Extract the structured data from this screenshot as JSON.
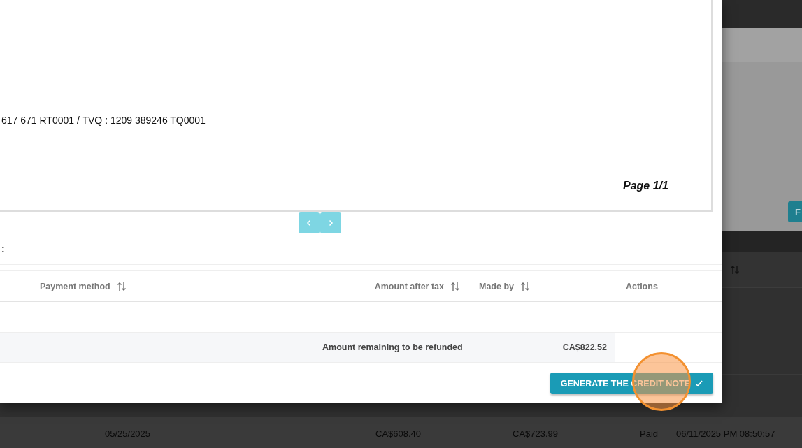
{
  "background": {
    "button": "F",
    "sort_column": {
      "sortable": true
    },
    "row": [
      "05/25/2025",
      "CA$608.40",
      "CA$723.99",
      "Paid",
      "06/11/2025 PM 08:50:57"
    ]
  },
  "dialog": {
    "document": {
      "tax_line": "617 671 RT0001 / TVQ : 1209 389246 TQ0001",
      "page": "Page 1/1"
    },
    "label": ":",
    "table": {
      "columns": [
        {
          "label": "Payment method",
          "sortable": true
        },
        {
          "label": "Amount after tax",
          "sortable": true
        },
        {
          "label": "Made by",
          "sortable": true
        },
        {
          "label": "Actions",
          "sortable": false
        }
      ],
      "summary": {
        "label": "Amount remaining to be refunded",
        "value": "CA$822.52"
      }
    },
    "button": "GENERATE THE CREDIT NOTE"
  }
}
